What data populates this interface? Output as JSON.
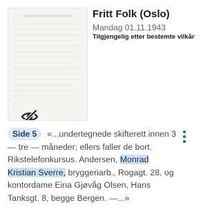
{
  "result": {
    "title": "Fritt Folk (Oslo)",
    "date": "Mandag 01.11.1943",
    "access": "Tilgjengelig etter bestemte vilkår",
    "thumbnail_icon": "eye-slash-icon",
    "menu_icon": "more-vert-icon",
    "page_badge": "Side 5",
    "snippet": {
      "part1": "«...undertegnede skifterett innen 3 — tre — måneder; ellers faller de bort. Rikstelefonkursus. Andersen, ",
      "highlight": "Monrad Kristian Sverre,",
      "part2": " bryggeriarb., Rogagt. 28, og kontordame Eina Gjøvåg Olsen, Hans Tanksgt. 8, begge Bergen. —...»"
    }
  },
  "colors": {
    "badge_bg": "#dfe9f5",
    "highlight_bg": "#cfe0f2",
    "accent": "#1a5fa8"
  }
}
